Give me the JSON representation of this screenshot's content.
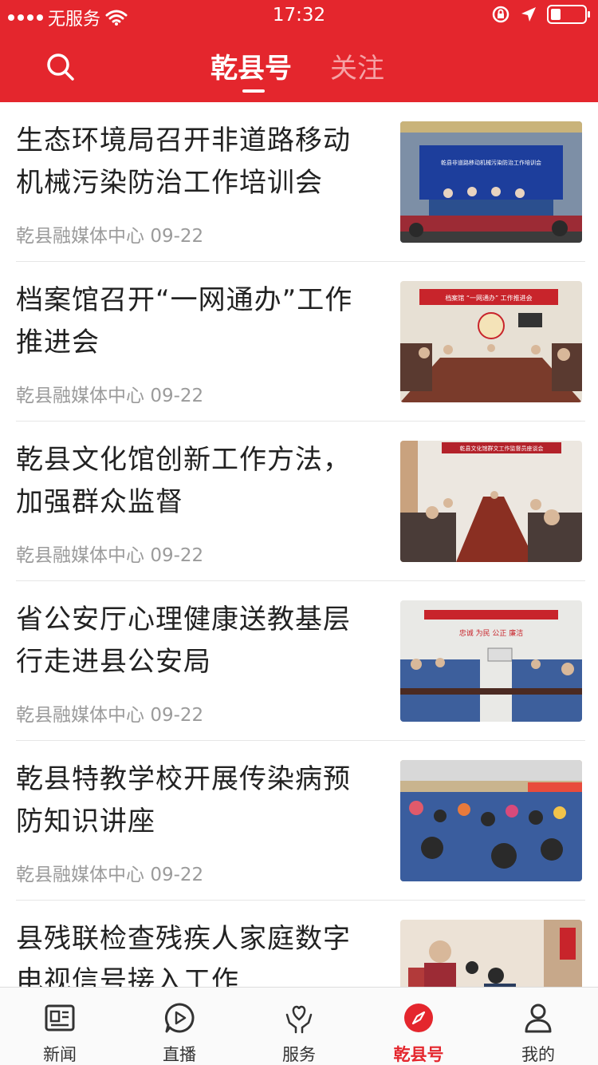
{
  "status_bar": {
    "carrier": "无服务",
    "time": "17:32"
  },
  "header": {
    "tabs": [
      {
        "label": "乾县号",
        "active": true
      },
      {
        "label": "关注",
        "active": false
      }
    ],
    "accent_color": "#e4262d"
  },
  "feed": {
    "items": [
      {
        "title": "生态环境局召开非道路移动机械污染防治工作培训会",
        "source": "乾县融媒体中心",
        "date": "09-22",
        "image_banner": "乾县非道路移动机械污染防治工作培训会"
      },
      {
        "title": "档案馆召开“一网通办”工作推进会",
        "source": "乾县融媒体中心",
        "date": "09-22",
        "image_banner": "档案馆 “一网通办” 工作推进会"
      },
      {
        "title": "乾县文化馆创新工作方法，加强群众监督",
        "source": "乾县融媒体中心",
        "date": "09-22",
        "image_banner": "乾县文化馆群文工作监督员座谈会"
      },
      {
        "title": "省公安厅心理健康送教基层行走进县公安局",
        "source": "乾县融媒体中心",
        "date": "09-22",
        "image_banner": "忠诚 为民 公正 廉洁"
      },
      {
        "title": "乾县特教学校开展传染病预防知识讲座",
        "source": "乾县融媒体中心",
        "date": "09-22",
        "image_banner": ""
      },
      {
        "title": "县残联检查残疾人家庭数字电视信号接入工作",
        "source": "",
        "date": "",
        "image_banner": ""
      }
    ]
  },
  "bottom_nav": {
    "items": [
      {
        "label": "新闻",
        "icon": "newspaper-icon"
      },
      {
        "label": "直播",
        "icon": "play-icon"
      },
      {
        "label": "服务",
        "icon": "heart-hands-icon"
      },
      {
        "label": "乾县号",
        "icon": "compass-icon",
        "active": true
      },
      {
        "label": "我的",
        "icon": "person-icon"
      }
    ]
  }
}
